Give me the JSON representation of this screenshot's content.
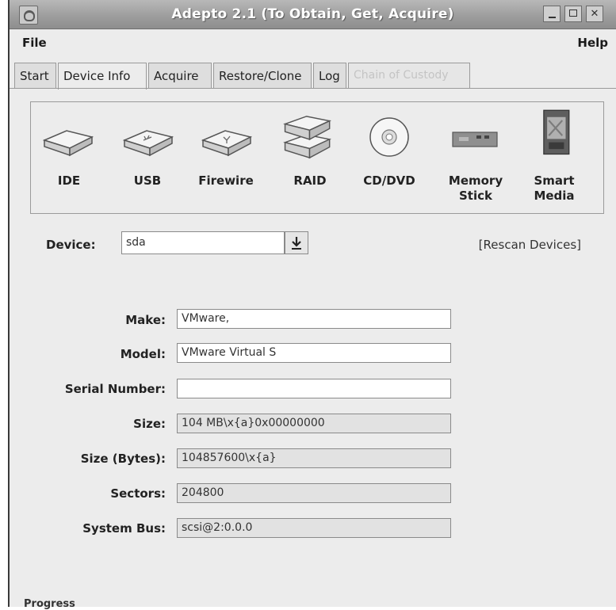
{
  "window": {
    "title": "Adepto 2.1 (To Obtain, Get, Acquire)"
  },
  "menubar": {
    "file": "File",
    "help": "Help"
  },
  "tabs": [
    {
      "label": "Start",
      "state": "normal"
    },
    {
      "label": "Device Info",
      "state": "active"
    },
    {
      "label": "Acquire",
      "state": "normal"
    },
    {
      "label": "Restore/Clone",
      "state": "normal"
    },
    {
      "label": "Log",
      "state": "normal"
    },
    {
      "label": "Chain of Custody",
      "state": "disabled"
    }
  ],
  "devices": [
    {
      "label": "IDE",
      "icon": "hard-disk-icon"
    },
    {
      "label": "USB",
      "icon": "usb-disk-icon"
    },
    {
      "label": "Firewire",
      "icon": "firewire-disk-icon"
    },
    {
      "label": "RAID",
      "icon": "raid-disks-icon"
    },
    {
      "label": "CD/DVD",
      "icon": "cd-dvd-icon"
    },
    {
      "label": "Memory\nStick",
      "icon": "memory-stick-icon"
    },
    {
      "label": "Smart\nMedia",
      "icon": "smart-media-icon"
    }
  ],
  "device_selector": {
    "label": "Device:",
    "value": "sda",
    "rescan": "[Rescan Devices]"
  },
  "fields": {
    "make": {
      "label": "Make:",
      "value": "VMware,"
    },
    "model": {
      "label": "Model:",
      "value": "VMware Virtual S"
    },
    "serial": {
      "label": "Serial Number:",
      "value": ""
    },
    "size": {
      "label": "Size:",
      "value": "104 MB\\x{a}0x00000000"
    },
    "size_bytes": {
      "label": "Size (Bytes):",
      "value": "104857600\\x{a}"
    },
    "sectors": {
      "label": "Sectors:",
      "value": "204800"
    },
    "system_bus": {
      "label": "System Bus:",
      "value": "scsi@2:0.0.0"
    }
  },
  "footer": {
    "progress_label": "Progress"
  }
}
